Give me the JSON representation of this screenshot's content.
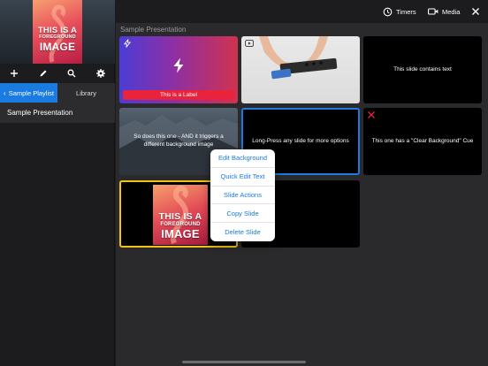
{
  "sidebar": {
    "preview": {
      "poster_lines": [
        "THIS IS A",
        "FOREGROUND",
        "IMAGE"
      ]
    },
    "toolbar": [
      {
        "name": "add-button",
        "icon": "plus-icon"
      },
      {
        "name": "edit-button",
        "icon": "pencil-icon"
      },
      {
        "name": "search-button",
        "icon": "search-icon"
      },
      {
        "name": "settings-button",
        "icon": "gear-icon"
      }
    ],
    "tabs": {
      "playlist": "Sample Playlist",
      "library": "Library"
    },
    "items": [
      {
        "label": "Sample Presentation"
      }
    ]
  },
  "topbar": {
    "timers": "Timers",
    "media": "Media"
  },
  "main": {
    "title": "Sample Presentation",
    "slides": [
      {
        "label": "This is a Label"
      },
      {
        "text": ""
      },
      {
        "text": "This slide contains text"
      },
      {
        "text": "So does this one - AND it triggers a different background image"
      },
      {
        "text": "Long-Press any slide for more options"
      },
      {
        "text": "This one has a \"Clear Background\" Cue"
      },
      {
        "poster_lines": [
          "THIS IS A",
          "FOREGROUND",
          "IMAGE"
        ]
      }
    ]
  },
  "context_menu": {
    "items": [
      "Edit Background",
      "Quick Edit Text",
      "Slide Actions",
      "Copy Slide",
      "Delete Slide"
    ]
  },
  "colors": {
    "accent": "#1a7be0",
    "selected_border": "#1a7be0",
    "live_border": "#f2c417",
    "label_red": "#e8233b"
  }
}
